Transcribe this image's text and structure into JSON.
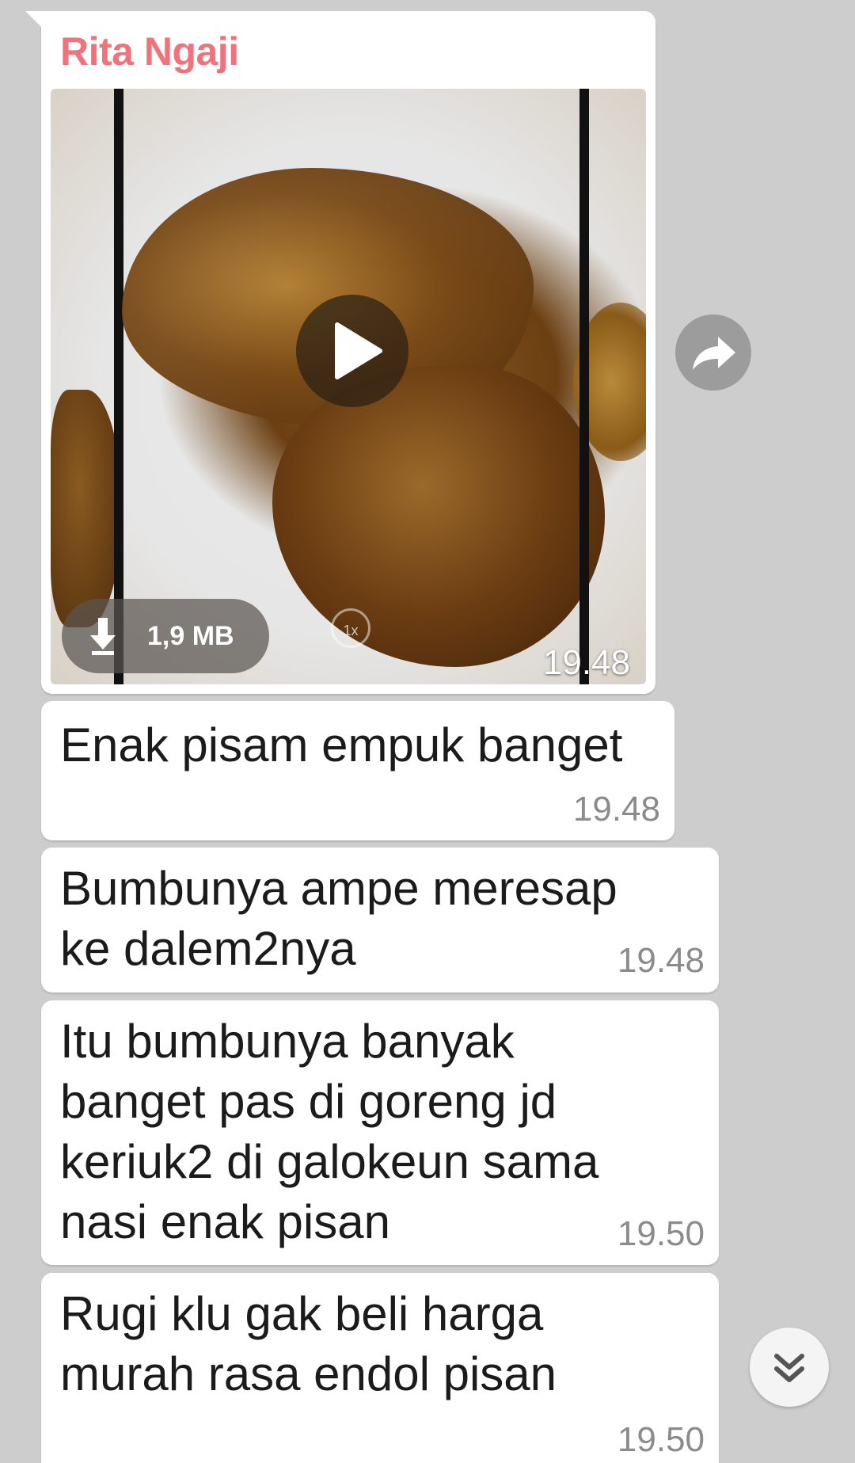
{
  "chat": {
    "sender_name": "Rita Ngaji",
    "video_message": {
      "file_size": "1,9 MB",
      "playback_speed": "1x",
      "time": "19.48"
    },
    "messages": [
      {
        "text": "Enak pisam empuk banget",
        "time": "19.48"
      },
      {
        "text": "Bumbunya ampe meresap\nke dalem2nya",
        "time": "19.48"
      },
      {
        "text": "Itu bumbunya banyak\nbanget pas di goreng jd\nkeriuk2 di galokeun sama\nnasi enak pisan",
        "time": "19.50"
      },
      {
        "text": "Rugi klu gak beli harga\nmurah rasa endol pisan",
        "time": "19.50"
      }
    ]
  },
  "icons": {
    "share": "share-arrow-icon",
    "play": "play-icon",
    "download": "download-arrow-icon",
    "scroll_down": "double-chevron-down-icon"
  },
  "colors": {
    "background": "#cdcdcd",
    "bubble": "#ffffff",
    "sender_name": "#f0737b",
    "timestamp": "#8b8b8b"
  }
}
